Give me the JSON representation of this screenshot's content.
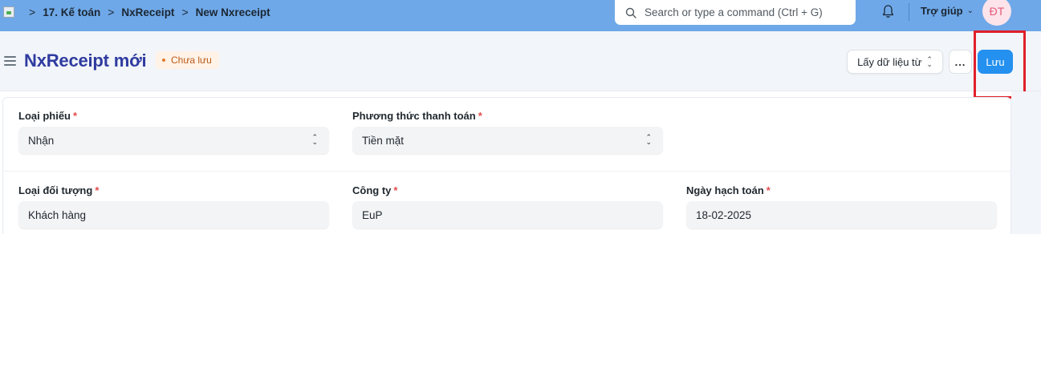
{
  "navbar": {
    "breadcrumbs": [
      "17. Kế toán",
      "NxReceipt",
      "New Nxreceipt"
    ],
    "search_placeholder": "Search or type a command (Ctrl + G)",
    "help_label": "Trợ giúp",
    "avatar_initials": "ĐT",
    "bar_color": "#6fa8e8"
  },
  "page": {
    "title": "NxReceipt mới",
    "status_badge": "Chưa lưu",
    "actions": {
      "fetch_label": "Lấy dữ liệu từ",
      "more_label": "...",
      "save_label": "Lưu"
    },
    "accent_color": "#2490ef"
  },
  "form": {
    "row1": [
      {
        "label": "Loại phiếu",
        "required": "*",
        "value": "Nhận",
        "type": "select"
      },
      {
        "label": "Phương thức thanh toán",
        "required": "*",
        "value": "Tiền mặt",
        "type": "select"
      }
    ],
    "row2": [
      {
        "label": "Loại đối tượng",
        "required": "*",
        "value": "Khách hàng",
        "type": "link"
      },
      {
        "label": "Công ty",
        "required": "*",
        "value": "EuP",
        "type": "link"
      },
      {
        "label": "Ngày hạch toán",
        "required": "*",
        "value": "18-02-2025",
        "type": "date"
      }
    ]
  }
}
